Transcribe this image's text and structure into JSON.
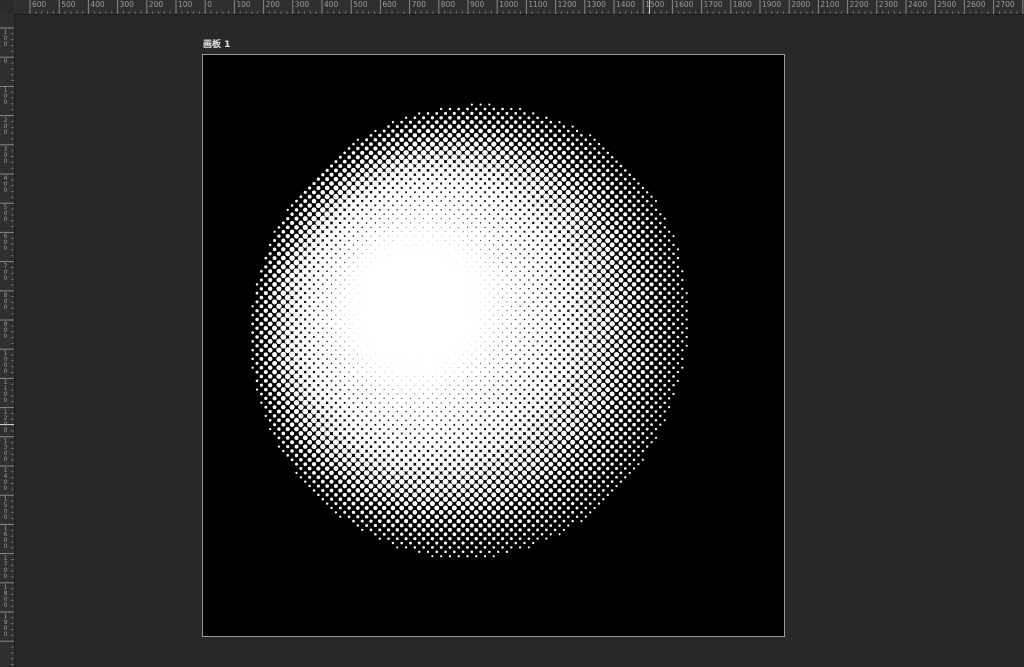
{
  "app": {
    "background": "#282828"
  },
  "ruler_horizontal": {
    "labels": [
      "600",
      "500",
      "400",
      "300",
      "200",
      "100",
      "0",
      "100",
      "200",
      "300",
      "400",
      "500",
      "600",
      "700",
      "800",
      "900",
      "1000",
      "1100",
      "1200",
      "1300",
      "1400",
      "1500",
      "1600",
      "1700",
      "1800",
      "1900",
      "2000",
      "2100",
      "2200",
      "2300",
      "2400",
      "2500",
      "2600",
      "2700"
    ]
  },
  "ruler_vertical": {
    "labels": [
      "100",
      "0",
      "100",
      "200",
      "300",
      "400",
      "500",
      "600",
      "700",
      "800",
      "900",
      "1000",
      "1100",
      "1200",
      "1300",
      "1400",
      "1500",
      "1600",
      "1700",
      "1800",
      "1900"
    ]
  },
  "artboard": {
    "title": "画板 1",
    "background": "#000000",
    "border_color": "#9a9a9a",
    "content": "halftone-gradient-circle"
  }
}
